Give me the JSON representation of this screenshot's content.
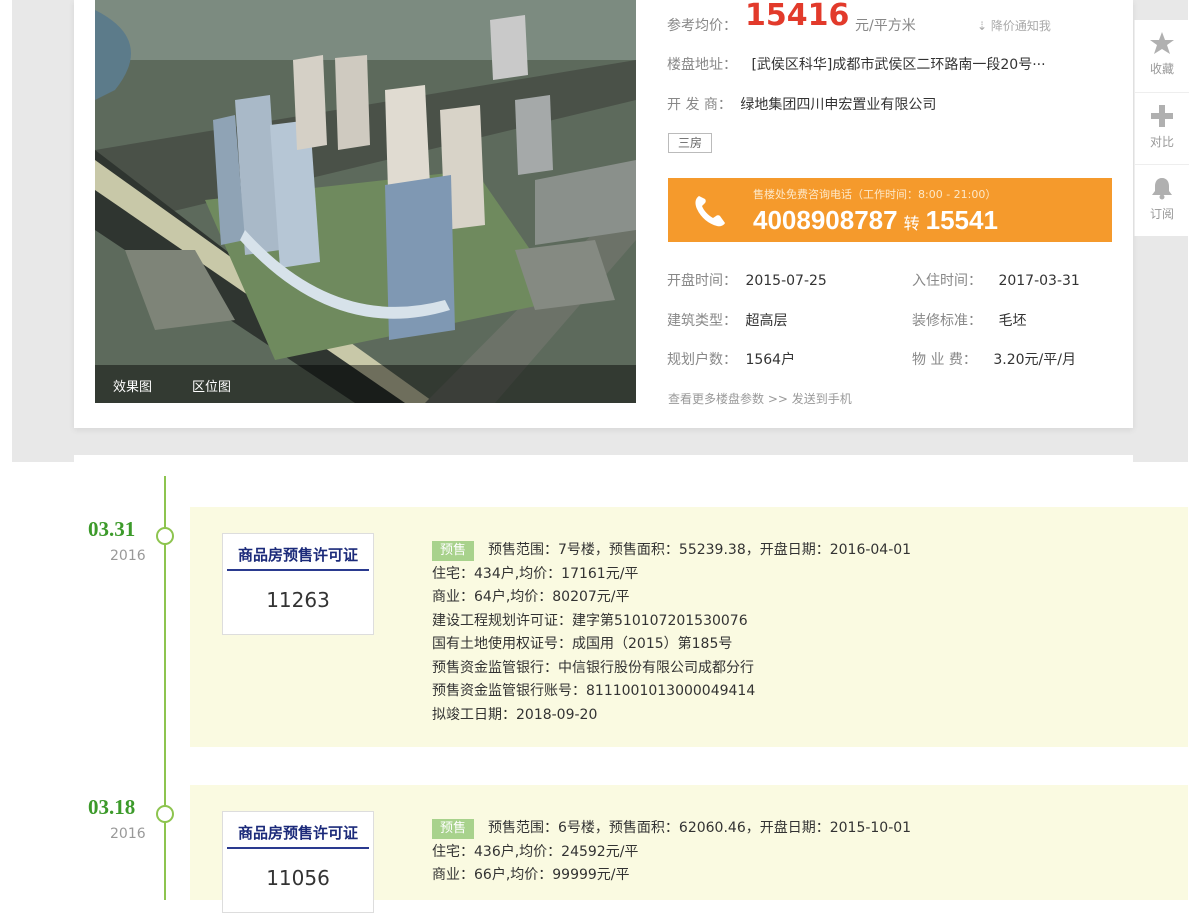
{
  "header": {
    "photo_tabs": [
      "效果图",
      "区位图"
    ],
    "price_label": "参考均价：",
    "price_value": "15416",
    "price_unit": "元/平方米",
    "price_alert": "降价通知我",
    "address_label": "楼盘地址：",
    "address_value": "[武侯区科华]成都市武侯区二环路南一段20号···",
    "developer_label": "开 发 商：",
    "developer_value": "绿地集团四川申宏置业有限公司",
    "tag": "三房",
    "hotline_hours": "售楼处免费咨询电话（工作时间：8:00 - 21:00）",
    "hotline_main": "4008908787",
    "hotline_zhuan": "转",
    "hotline_ext": "15541",
    "open_label": "开盘时间：",
    "open_value": "2015-07-25",
    "checkin_label": "入住时间：",
    "checkin_value": "2017-03-31",
    "building_label": "建筑类型：",
    "building_value": "超高层",
    "decor_label": "装修标准：",
    "decor_value": "毛坯",
    "units_label": "规划户数：",
    "units_value": "1564户",
    "fee_label": "物 业 费：",
    "fee_value": "3.20元/平/月",
    "more_link": "查看更多楼盘参数 >> 发送到手机"
  },
  "side_tools": [
    "收藏",
    "对比",
    "订阅"
  ],
  "timeline": [
    {
      "date": "03.31",
      "year": "2016",
      "permit_title": "商品房预售许可证",
      "permit_number": "11263",
      "badge": "预售",
      "lines": [
        "预售范围：7号楼，预售面积：55239.38，开盘日期：2016-04-01",
        "住宅：434户,均价：17161元/平",
        "商业：64户,均价：80207元/平",
        "建设工程规划许可证：建字第510107201530076",
        "国有土地使用权证号：成国用（2015）第185号",
        "预售资金监管银行：中信银行股份有限公司成都分行",
        "预售资金监管银行账号：8111001013000049414",
        "拟竣工日期：2018-09-20"
      ]
    },
    {
      "date": "03.18",
      "year": "2016",
      "permit_title": "商品房预售许可证",
      "permit_number": "11056",
      "badge": "预售",
      "lines": [
        "预售范围：6号楼，预售面积：62060.46，开盘日期：2015-10-01",
        "住宅：436户,均价：24592元/平",
        "商业：66户,均价：99999元/平"
      ]
    }
  ]
}
